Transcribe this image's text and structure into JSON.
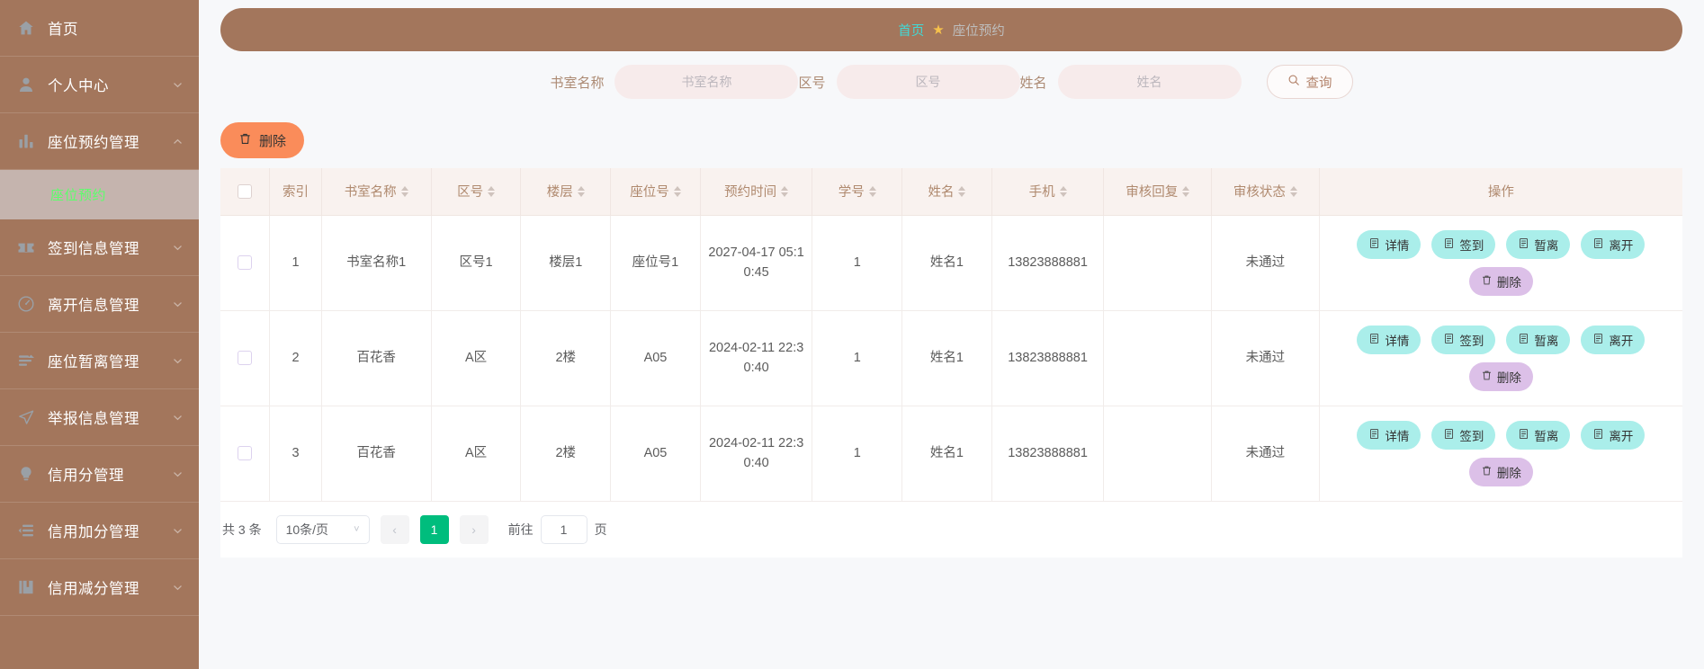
{
  "sidebar": {
    "items": [
      {
        "label": "首页",
        "icon": "home-icon",
        "expandable": false
      },
      {
        "label": "个人中心",
        "icon": "user-icon",
        "expandable": true
      },
      {
        "label": "座位预约管理",
        "icon": "bar-chart-icon",
        "expandable": true,
        "expanded": true,
        "children": [
          {
            "label": "座位预约",
            "active": true
          }
        ]
      },
      {
        "label": "签到信息管理",
        "icon": "ticket-icon",
        "expandable": true
      },
      {
        "label": "离开信息管理",
        "icon": "odometer-icon",
        "expandable": true
      },
      {
        "label": "座位暂离管理",
        "icon": "sort-list-icon",
        "expandable": true
      },
      {
        "label": "举报信息管理",
        "icon": "send-icon",
        "expandable": true
      },
      {
        "label": "信用分管理",
        "icon": "bulb-icon",
        "expandable": true
      },
      {
        "label": "信用加分管理",
        "icon": "list-indent-icon",
        "expandable": true
      },
      {
        "label": "信用减分管理",
        "icon": "notebook-icon",
        "expandable": true
      }
    ]
  },
  "breadcrumb": {
    "home": "首页",
    "separator_icon": "star-icon",
    "current": "座位预约"
  },
  "search": {
    "fields": [
      {
        "label": "书室名称",
        "placeholder": "书室名称",
        "value": ""
      },
      {
        "label": "区号",
        "placeholder": "区号",
        "value": ""
      },
      {
        "label": "姓名",
        "placeholder": "姓名",
        "value": ""
      }
    ],
    "query_label": "查询",
    "query_icon": "search-icon"
  },
  "toolbar": {
    "delete_label": "删除",
    "delete_icon": "trash-icon"
  },
  "table": {
    "columns": [
      {
        "key": "checkbox",
        "label": "",
        "sortable": false
      },
      {
        "key": "index",
        "label": "索引",
        "sortable": false
      },
      {
        "key": "room",
        "label": "书室名称",
        "sortable": true
      },
      {
        "key": "zone",
        "label": "区号",
        "sortable": true
      },
      {
        "key": "floor",
        "label": "楼层",
        "sortable": true
      },
      {
        "key": "seat",
        "label": "座位号",
        "sortable": true
      },
      {
        "key": "time",
        "label": "预约时间",
        "sortable": true
      },
      {
        "key": "sid",
        "label": "学号",
        "sortable": true
      },
      {
        "key": "name",
        "label": "姓名",
        "sortable": true
      },
      {
        "key": "phone",
        "label": "手机",
        "sortable": true
      },
      {
        "key": "reply",
        "label": "审核回复",
        "sortable": true
      },
      {
        "key": "status",
        "label": "审核状态",
        "sortable": true
      },
      {
        "key": "ops",
        "label": "操作",
        "sortable": false
      }
    ],
    "rows": [
      {
        "index": "1",
        "room": "书室名称1",
        "zone": "区号1",
        "floor": "楼层1",
        "seat": "座位号1",
        "time": "2027-04-17 05:10:45",
        "sid": "1",
        "name": "姓名1",
        "phone": "13823888881",
        "reply": "",
        "status": "未通过"
      },
      {
        "index": "2",
        "room": "百花香",
        "zone": "A区",
        "floor": "2楼",
        "seat": "A05",
        "time": "2024-02-11 22:30:40",
        "sid": "1",
        "name": "姓名1",
        "phone": "13823888881",
        "reply": "",
        "status": "未通过"
      },
      {
        "index": "3",
        "room": "百花香",
        "zone": "A区",
        "floor": "2楼",
        "seat": "A05",
        "time": "2024-02-11 22:30:40",
        "sid": "1",
        "name": "姓名1",
        "phone": "13823888881",
        "reply": "",
        "status": "未通过"
      }
    ],
    "row_actions": [
      {
        "label": "详情",
        "icon": "document-icon",
        "color": "cyan"
      },
      {
        "label": "签到",
        "icon": "document-icon",
        "color": "cyan"
      },
      {
        "label": "暂离",
        "icon": "document-icon",
        "color": "cyan"
      },
      {
        "label": "离开",
        "icon": "document-icon",
        "color": "cyan"
      },
      {
        "label": "删除",
        "icon": "trash-icon",
        "color": "purple"
      }
    ]
  },
  "pagination": {
    "total_text": "共 3 条",
    "page_size_label": "10条/页",
    "prev_icon": "chevron-left-icon",
    "next_icon": "chevron-right-icon",
    "current_page": "1",
    "jump_prefix": "前往",
    "jump_value": "1",
    "jump_suffix": "页"
  },
  "colors": {
    "sidebar_bg": "#a3765c",
    "sidebar_active_bg": "#c5b4ae",
    "sidebar_active_text": "#5cff6b",
    "accent_cyan": "#41d9d6",
    "star": "#f6c14b",
    "delete_orange": "#fa8c5a",
    "op_cyan": "#aaeeea",
    "op_purple": "#dcc0e8",
    "page_green": "#00bd7d",
    "table_header_bg": "#f9f2ef",
    "input_bg": "#f7ebeb"
  }
}
